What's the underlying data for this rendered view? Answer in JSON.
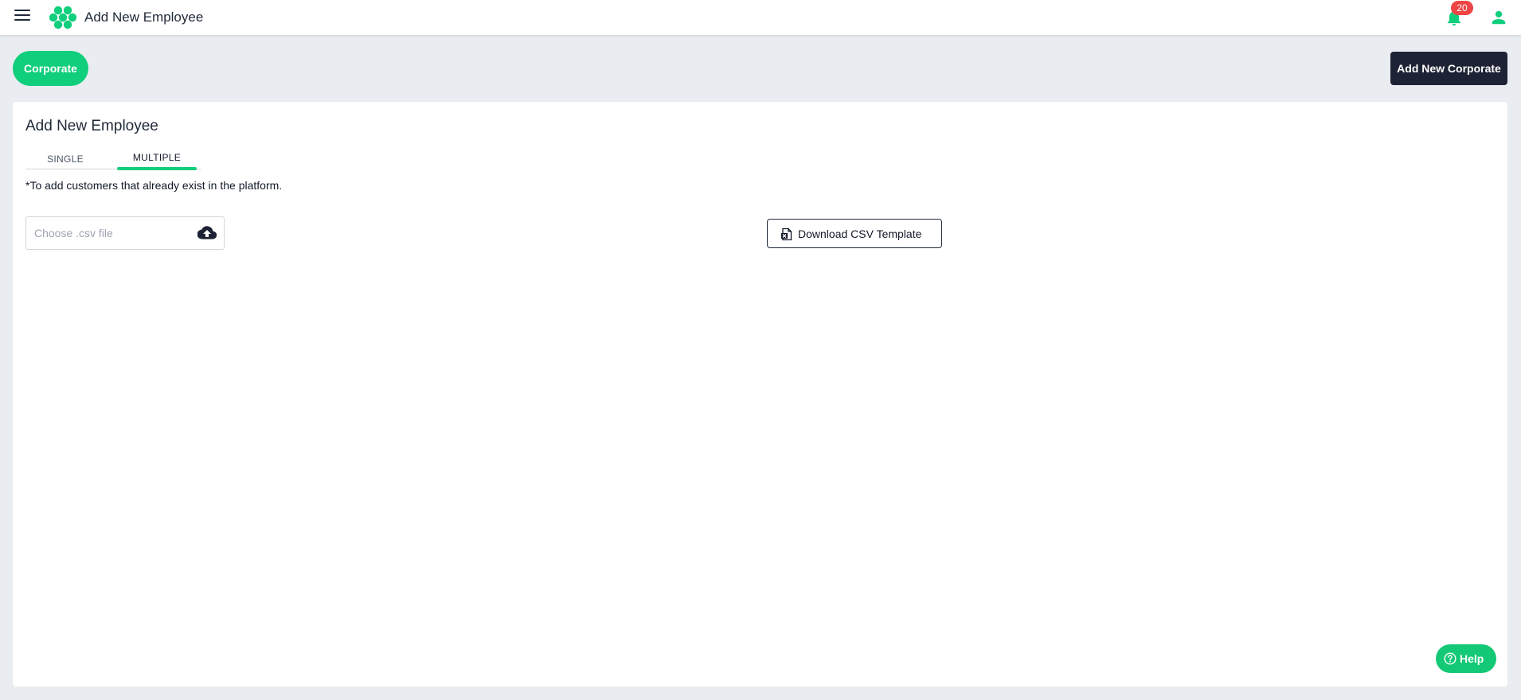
{
  "header": {
    "title": "Add New Employee",
    "notification_count": "20"
  },
  "toolbar": {
    "corporate_label": "Corporate",
    "add_corporate_label": "Add New Corporate"
  },
  "card": {
    "title": "Add New Employee",
    "tabs": [
      {
        "label": "SINGLE",
        "active": false
      },
      {
        "label": "MULTIPLE",
        "active": true
      }
    ],
    "note": "*To add customers that already exist in the platform.",
    "file_input": {
      "placeholder": "Choose .csv file"
    },
    "download_label": "Download CSV Template"
  },
  "help": {
    "label": "Help"
  },
  "colors": {
    "accent": "#0fce7c",
    "dark": "#1e2235",
    "badge": "#ef4444",
    "background": "#e9ecf1"
  },
  "icons": [
    "menu-icon",
    "logo-icon",
    "bell-icon",
    "user-icon",
    "upload-cloud-icon",
    "excel-icon",
    "question-icon"
  ]
}
